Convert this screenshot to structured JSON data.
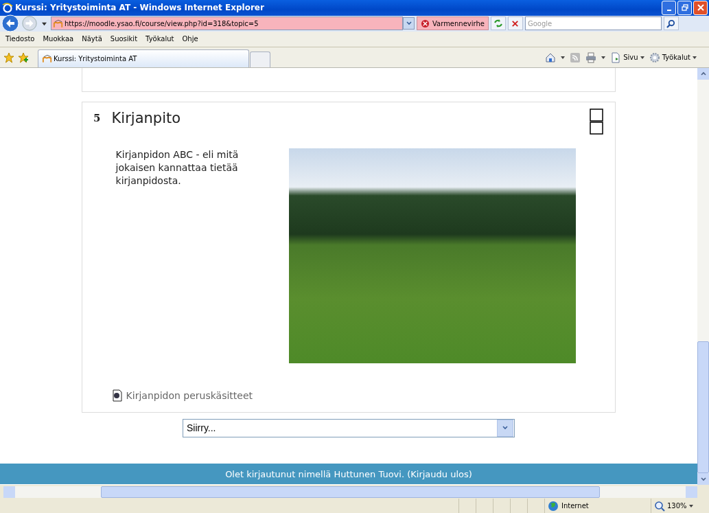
{
  "window": {
    "title": "Kurssi: Yritystoiminta AT - Windows Internet Explorer"
  },
  "address_bar": {
    "url": "https://moodle.ysao.fi/course/view.php?id=318&topic=5",
    "security_label": "Varmennevirhe",
    "search_placeholder": "Google"
  },
  "menu": [
    "Tiedosto",
    "Muokkaa",
    "Näytä",
    "Suosikit",
    "Työkalut",
    "Ohje"
  ],
  "tabs": [
    {
      "label": "Kurssi: Yritystoiminta AT",
      "selected": true
    }
  ],
  "command_bar": {
    "page_label": "Sivu",
    "tools_label": "Työkalut"
  },
  "section": {
    "number": "5",
    "title": "Kirjanpito",
    "summary": "Kirjanpidon ABC - eli mitä jokaisen kannattaa tietää kirjanpidosta.",
    "resources": [
      "Kirjanpidon peruskäsitteet"
    ]
  },
  "jump_menu": {
    "value": "Siirry..."
  },
  "footer": {
    "text_before": "Olet kirjautunut nimellä Huttunen Tuovi. (",
    "link": "Kirjaudu ulos",
    "text_after": ")"
  },
  "status_bar": {
    "zone": "Internet",
    "zoom": "130%"
  }
}
